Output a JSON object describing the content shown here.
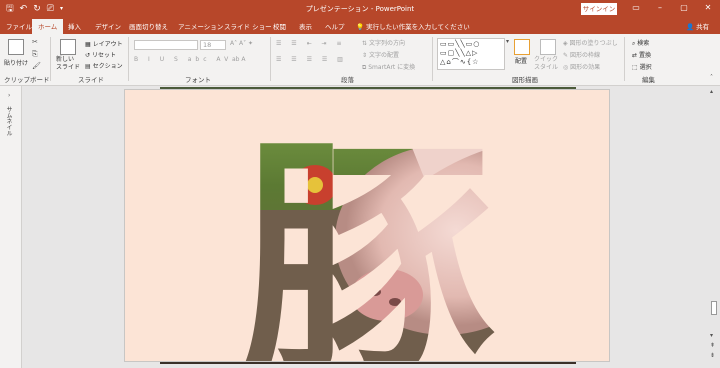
{
  "title_bar": {
    "document_title": "プレゼンテーション - PowerPoint",
    "signin_label": "サインイン"
  },
  "tabs": [
    {
      "label": "ファイル"
    },
    {
      "label": "ホーム",
      "active": true
    },
    {
      "label": "挿入"
    },
    {
      "label": "デザイン"
    },
    {
      "label": "画面切り替え"
    },
    {
      "label": "アニメーション"
    },
    {
      "label": "スライド ショー"
    },
    {
      "label": "校閲"
    },
    {
      "label": "表示"
    },
    {
      "label": "ヘルプ"
    }
  ],
  "tell_me": "実行したい作業を入力してください",
  "share_label": "共有",
  "ribbon": {
    "clipboard": {
      "paste": "貼り付け",
      "group": "クリップボード"
    },
    "slides": {
      "new_slide": "新しい\nスライド",
      "layout": "レイアウト",
      "reset": "リセット",
      "section": "セクション",
      "group": "スライド"
    },
    "font": {
      "size": "18",
      "group": "フォント"
    },
    "paragraph": {
      "text_direction": "文字列の方向",
      "align_text": "文字の配置",
      "smartart": "SmartArt に変換",
      "group": "段落"
    },
    "drawing": {
      "arrange": "配置",
      "quick_styles": "クイック\nスタイル",
      "fill": "図形の塗りつぶし",
      "outline": "図形の枠線",
      "effects": "図形の効果",
      "group": "図形描画"
    },
    "editing": {
      "find": "検索",
      "replace": "置換",
      "select": "選択",
      "group": "編集"
    }
  },
  "left_pane": {
    "label": "サムネイル"
  },
  "slide": {
    "character": "豚"
  },
  "colors": {
    "accent": "#b7472a",
    "slide_bg": "#fce4d6"
  }
}
